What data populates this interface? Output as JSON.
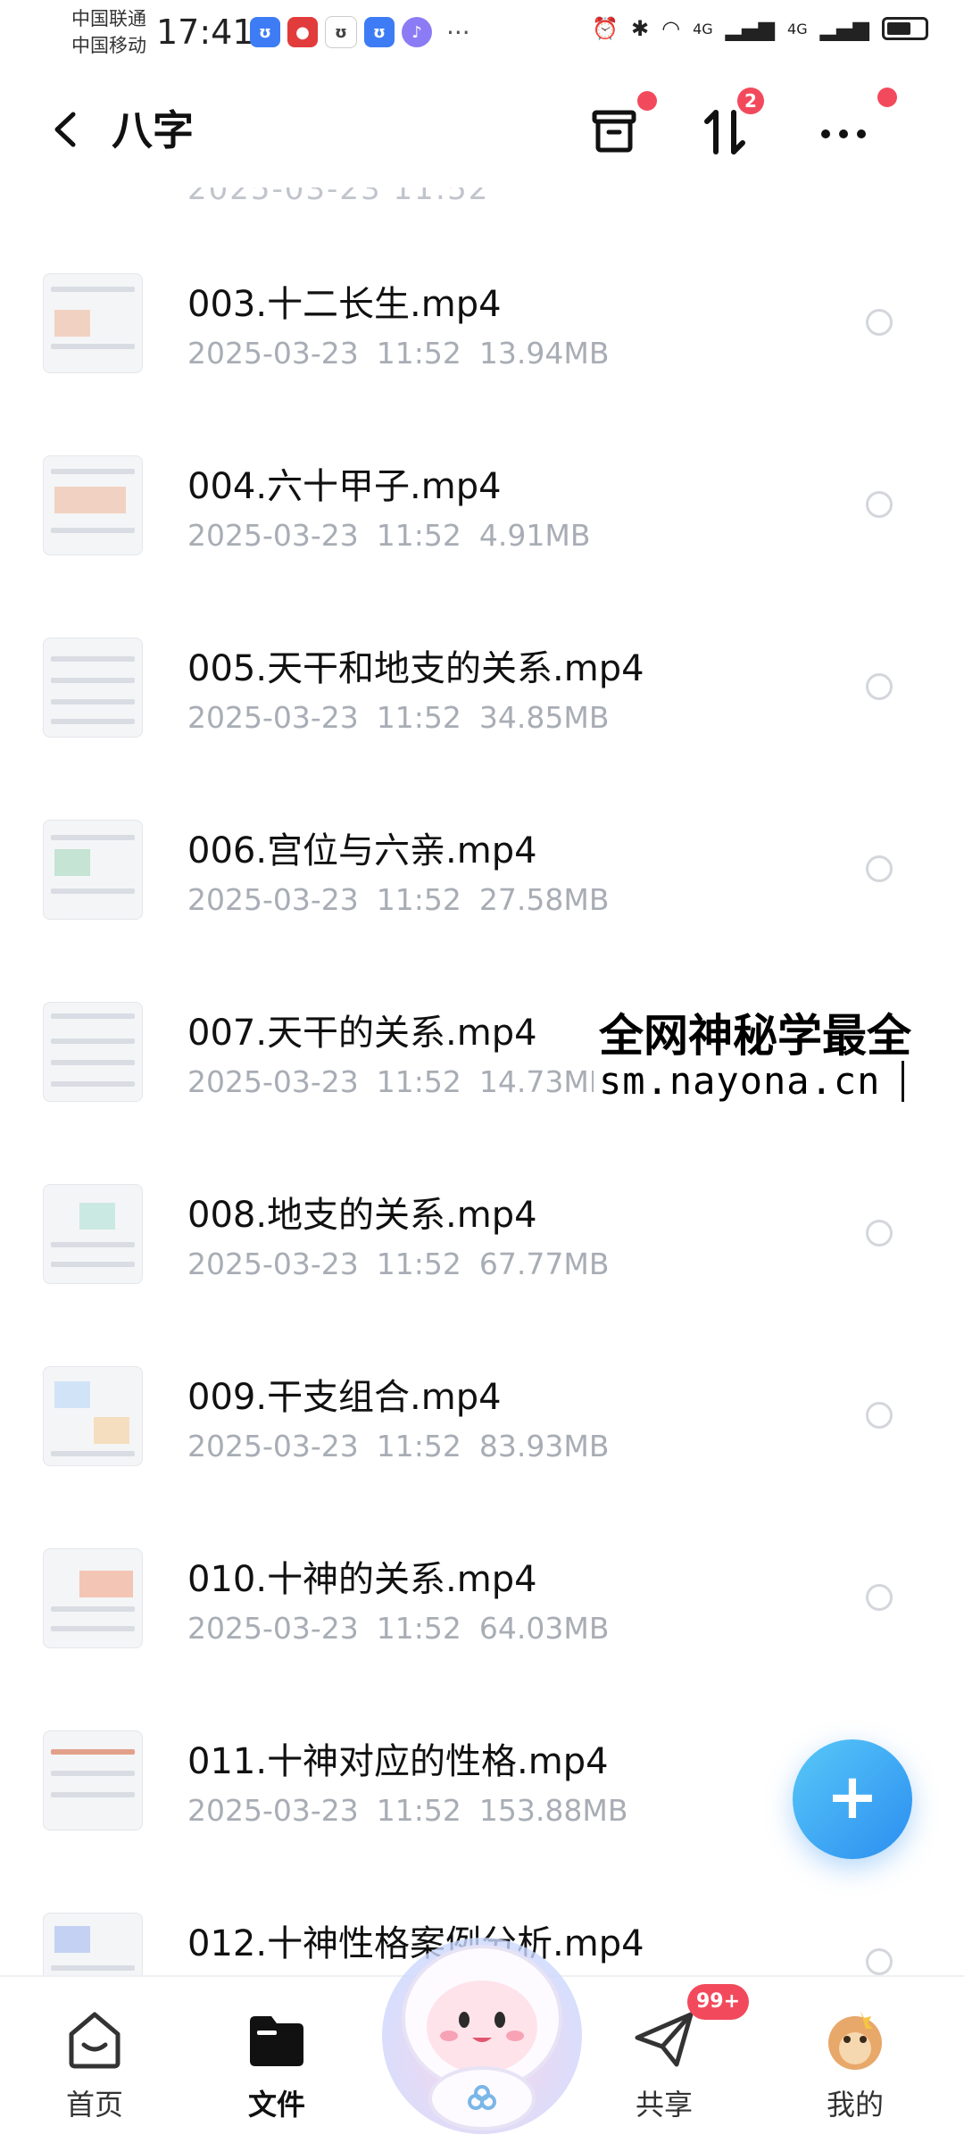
{
  "status_bar": {
    "carrier_1": "中国联通",
    "carrier_2": "中国移动",
    "time": "17:41",
    "signal_1": "4G",
    "signal_2": "4G"
  },
  "header": {
    "title": "八字",
    "transfer_badge": "2"
  },
  "files": [
    {
      "name": "003.十二长生.mp4",
      "date": "2025-03-23",
      "time": "11:52",
      "size": "13.94MB"
    },
    {
      "name": "004.六十甲子.mp4",
      "date": "2025-03-23",
      "time": "11:52",
      "size": "4.91MB"
    },
    {
      "name": "005.天干和地支的关系.mp4",
      "date": "2025-03-23",
      "time": "11:52",
      "size": "34.85MB"
    },
    {
      "name": "006.宫位与六亲.mp4",
      "date": "2025-03-23",
      "time": "11:52",
      "size": "27.58MB"
    },
    {
      "name": "007.天干的关系.mp4",
      "date": "2025-03-23",
      "time": "11:52",
      "size": "14.73MB"
    },
    {
      "name": "008.地支的关系.mp4",
      "date": "2025-03-23",
      "time": "11:52",
      "size": "67.77MB"
    },
    {
      "name": "009.干支组合.mp4",
      "date": "2025-03-23",
      "time": "11:52",
      "size": "83.93MB"
    },
    {
      "name": "010.十神的关系.mp4",
      "date": "2025-03-23",
      "time": "11:52",
      "size": "64.03MB"
    },
    {
      "name": "011.十神对应的性格.mp4",
      "date": "2025-03-23",
      "time": "11:52",
      "size": "153.88MB"
    },
    {
      "name": "012.十神性格案例分析.mp4",
      "date": "",
      "time": "",
      "size": ""
    }
  ],
  "watermark": {
    "title": "全网神秘学最全",
    "url": "sm.nayona.cn"
  },
  "fab": {
    "label": "+"
  },
  "bottom_nav": {
    "home": "首页",
    "files": "文件",
    "share": "共享",
    "share_badge": "99+",
    "mine": "我的"
  }
}
